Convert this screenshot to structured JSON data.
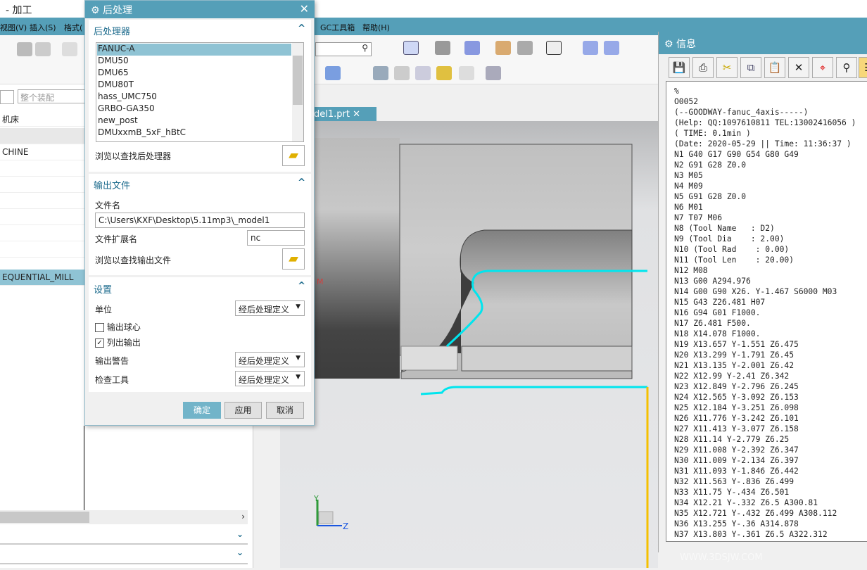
{
  "app": {
    "title": "- 加工"
  },
  "menu": [
    "视图(V)",
    "插入(S)",
    "格式(",
    "GC工具箱",
    "帮助(H)"
  ],
  "toolbar": {
    "filter_value": "整个装配"
  },
  "left_panel": {
    "rows": [
      "机床",
      "",
      "CHINE",
      "",
      "",
      "",
      "",
      "",
      "",
      "",
      "EQUENTIAL_MILL"
    ]
  },
  "viewport": {
    "tab_label": "del1.prt",
    "axis_y": "Y",
    "axis_z": "Z",
    "wcs_label": "M",
    "colors": {
      "toolpath": "#00e5ee",
      "boundary": "#f5c000"
    }
  },
  "dialog": {
    "title": "后处理",
    "postprocessor": {
      "header": "后处理器",
      "items": [
        "FANUC-A",
        "DMU50",
        "DMU65",
        "DMU80T",
        "hass_UMC750",
        "GRBO-GA350",
        "new_post",
        "DMUxxmB_5xF_hBtC"
      ],
      "selected": "FANUC-A",
      "browse_label": "浏览以查找后处理器"
    },
    "output": {
      "header": "输出文件",
      "filename_label": "文件名",
      "filename_value": "C:\\Users\\KXF\\Desktop\\5.11mp3\\_model1",
      "ext_label": "文件扩展名",
      "ext_value": "nc",
      "browse_label": "浏览以查找输出文件"
    },
    "settings": {
      "header": "设置",
      "unit_label": "单位",
      "unit_value": "经后处理定义",
      "ball_label": "输出球心",
      "ball_checked": false,
      "list_label": "列出输出",
      "list_checked": true,
      "warn_label": "输出警告",
      "warn_value": "经后处理定义",
      "check_label": "检查工具",
      "check_value": "经后处理定义"
    },
    "buttons": {
      "ok": "确定",
      "apply": "应用",
      "cancel": "取消"
    },
    "accent": "#559fb8"
  },
  "info": {
    "title": "信息",
    "toolbar_icons": [
      "save-icon",
      "print-icon",
      "cut-icon",
      "copy-icon",
      "paste-icon",
      "delete-icon",
      "target-icon",
      "find-icon",
      "text-icon"
    ],
    "lines": [
      "%",
      "O0052",
      "(--GOODWAY-fanuc_4axis-----)",
      "(Help: QQ:1097610811 TEL:13002416056 )",
      "( TIME: 0.1min )",
      "(Date: 2020-05-29 || Time: 11:36:37 )",
      "N1 G40 G17 G90 G54 G80 G49",
      "N2 G91 G28 Z0.0",
      "N3 M05",
      "N4 M09",
      "N5 G91 G28 Z0.0",
      "N6 M01",
      "N7 T07 M06",
      "N8 (Tool Name   : D2)",
      "N9 (Tool Dia    : 2.00)",
      "N10 (Tool Rad    : 0.00)",
      "N11 (Tool Len    : 20.00)",
      "N12 M08",
      "N13 G00 A294.976",
      "N14 G00 G90 X26. Y-1.467 S6000 M03",
      "N15 G43 Z26.481 H07",
      "N16 G94 G01 F1000.",
      "N17 Z6.481 F500.",
      "N18 X14.078 F1000.",
      "N19 X13.657 Y-1.551 Z6.475",
      "N20 X13.299 Y-1.791 Z6.45",
      "N21 X13.135 Y-2.001 Z6.42",
      "N22 X12.99 Y-2.41 Z6.342",
      "N23 X12.849 Y-2.796 Z6.245",
      "N24 X12.565 Y-3.092 Z6.153",
      "N25 X12.184 Y-3.251 Z6.098",
      "N26 X11.776 Y-3.242 Z6.101",
      "N27 X11.413 Y-3.077 Z6.158",
      "N28 X11.14 Y-2.779 Z6.25",
      "N29 X11.008 Y-2.392 Z6.347",
      "N30 X11.009 Y-2.134 Z6.397",
      "N31 X11.093 Y-1.846 Z6.442",
      "N32 X11.563 Y-.836 Z6.499",
      "N33 X11.75 Y-.434 Z6.501",
      "N34 X12.21 Y-.332 Z6.5 A300.81",
      "N35 X12.721 Y-.432 Z6.499 A308.112",
      "N36 X13.255 Y-.36 A314.878",
      "N37 X13.803 Y-.361 Z6.5 A322.312"
    ]
  },
  "watermark": "WWW.3DSJW.COM"
}
